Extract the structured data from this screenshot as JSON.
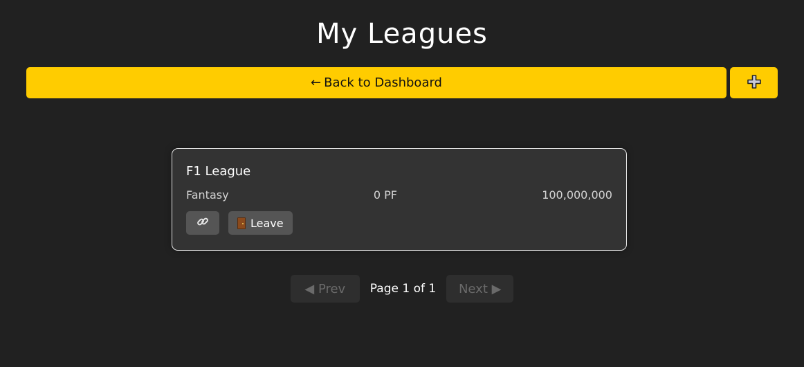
{
  "header": {
    "title": "My Leagues"
  },
  "toolbar": {
    "back_arrow": "←",
    "back_label": "Back to Dashboard",
    "add_icon": "plus-icon"
  },
  "leagues": [
    {
      "name": "F1 League",
      "type": "Fantasy",
      "points": "0 PF",
      "budget": "100,000,000",
      "copy_icon": "link-icon",
      "leave_icon": "door-icon",
      "leave_label": "Leave"
    }
  ],
  "pagination": {
    "prev_label": "◀ Prev",
    "page_indicator": "Page 1 of 1",
    "next_label": "Next ▶"
  },
  "colors": {
    "background": "#212121",
    "accent": "#ffcc00",
    "card": "#333333",
    "card_border": "#e8e8e8",
    "button": "#555555"
  }
}
